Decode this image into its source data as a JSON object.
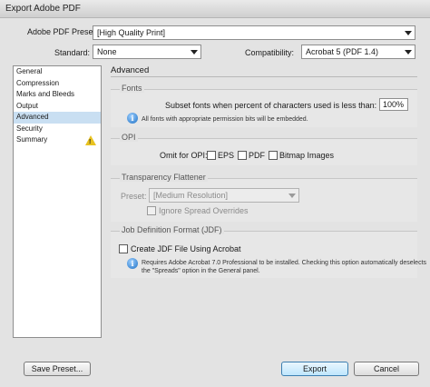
{
  "window": {
    "title": "Export Adobe PDF"
  },
  "top": {
    "preset_label": "Adobe PDF Preset:",
    "preset_value": "[High Quality Print]",
    "standard_label": "Standard:",
    "standard_value": "None",
    "compat_label": "Compatibility:",
    "compat_value": "Acrobat 5 (PDF 1.4)"
  },
  "sidebar": {
    "items": [
      {
        "label": "General"
      },
      {
        "label": "Compression"
      },
      {
        "label": "Marks and Bleeds"
      },
      {
        "label": "Output"
      },
      {
        "label": "Advanced"
      },
      {
        "label": "Security"
      },
      {
        "label": "Summary"
      }
    ],
    "selected": "Advanced"
  },
  "panel": {
    "title": "Advanced",
    "fonts": {
      "title": "Fonts",
      "subset_label": "Subset fonts when percent of characters used is less than:",
      "subset_value": "100%",
      "info": "All fonts with appropriate permission bits will be embedded."
    },
    "opi": {
      "title": "OPI",
      "omit_label": "Omit for OPI:",
      "eps": "EPS",
      "pdf": "PDF",
      "bitmap": "Bitmap Images"
    },
    "flattener": {
      "title": "Transparency Flattener",
      "preset_label": "Preset:",
      "preset_value": "[Medium Resolution]",
      "ignore_label": "Ignore Spread Overrides"
    },
    "jdf": {
      "title": "Job Definition Format (JDF)",
      "create_label": "Create JDF File Using Acrobat",
      "info_line1": "Requires Adobe Acrobat 7.0 Professional to be installed. Checking this option automatically deselects",
      "info_line2": "the \"Spreads\" option in the General panel."
    }
  },
  "buttons": {
    "save_preset": "Save Preset...",
    "export": "Export",
    "cancel": "Cancel"
  }
}
